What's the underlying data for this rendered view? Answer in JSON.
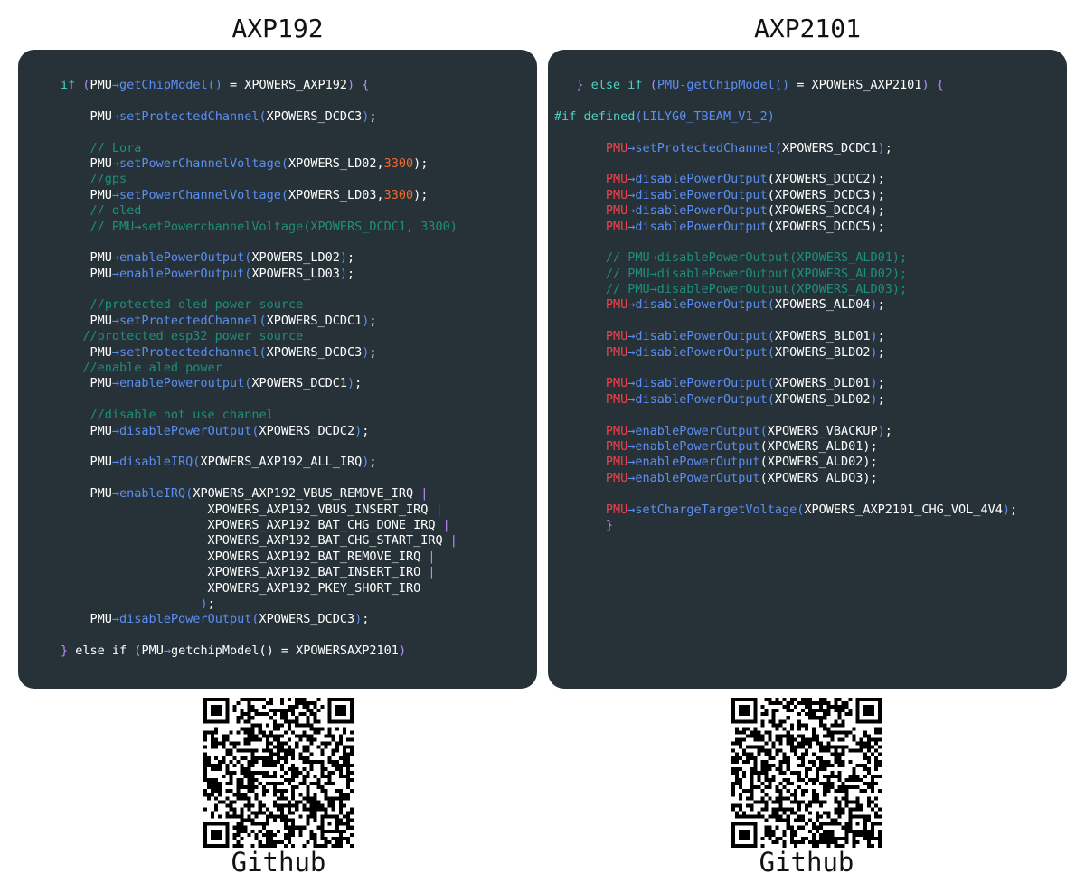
{
  "left": {
    "title": "AXP192",
    "qr_caption": "Github",
    "code": [
      {
        "indent": 0,
        "t": [
          [
            "k",
            "if "
          ],
          [
            "p",
            "("
          ],
          [
            "w",
            "PMU"
          ],
          [
            "f",
            "→getChipModel()"
          ],
          [
            "w",
            " = XPOWERS_AXP192"
          ],
          [
            "p",
            ")"
          ],
          [
            "w",
            " "
          ],
          [
            "p",
            "{"
          ]
        ]
      },
      {
        "indent": 0,
        "t": []
      },
      {
        "indent": 0,
        "t": [
          [
            "w",
            "    PMU"
          ],
          [
            "f",
            "→setProtectedChannel("
          ],
          [
            "w",
            "XPOWERS_DCDC3"
          ],
          [
            "f",
            ")"
          ],
          [
            "w",
            ";"
          ]
        ]
      },
      {
        "indent": 0,
        "t": []
      },
      {
        "indent": 0,
        "t": [
          [
            "c",
            "    // Lora"
          ]
        ]
      },
      {
        "indent": 0,
        "t": [
          [
            "w",
            "    PMU"
          ],
          [
            "f",
            "→setPowerChannelVoltage("
          ],
          [
            "w",
            "XPOWERS_LD02,"
          ],
          [
            "n",
            "3300"
          ],
          [
            "w",
            ");"
          ]
        ]
      },
      {
        "indent": 0,
        "t": [
          [
            "c",
            "    //gps"
          ]
        ]
      },
      {
        "indent": 0,
        "t": [
          [
            "w",
            "    PMU"
          ],
          [
            "f",
            "→setPowerChannelVoltage("
          ],
          [
            "w",
            "XPOWERS_LD03,"
          ],
          [
            "n",
            "3300"
          ],
          [
            "w",
            ");"
          ]
        ]
      },
      {
        "indent": 0,
        "t": [
          [
            "c",
            "    // oled"
          ]
        ]
      },
      {
        "indent": 0,
        "t": [
          [
            "c",
            "    // PMU→setPowerchannelVoltage(XPOWERS_DCDC1, 3300)"
          ]
        ]
      },
      {
        "indent": 0,
        "t": []
      },
      {
        "indent": 0,
        "t": [
          [
            "w",
            "    PMU"
          ],
          [
            "f",
            "→enablePowerOutput("
          ],
          [
            "w",
            "XPOWERS_LD02"
          ],
          [
            "f",
            ")"
          ],
          [
            "w",
            ";"
          ]
        ]
      },
      {
        "indent": 0,
        "t": [
          [
            "w",
            "    PMU"
          ],
          [
            "f",
            "→enablePowerOutput("
          ],
          [
            "w",
            "XPOWERS_LD03"
          ],
          [
            "f",
            ")"
          ],
          [
            "w",
            ";"
          ]
        ]
      },
      {
        "indent": 0,
        "t": []
      },
      {
        "indent": 0,
        "t": [
          [
            "c",
            "    //protected oled power source"
          ]
        ]
      },
      {
        "indent": 0,
        "t": [
          [
            "w",
            "    PMU"
          ],
          [
            "f",
            "→setProtectedChannel("
          ],
          [
            "w",
            "XPOWERS_DCDC1"
          ],
          [
            "f",
            ")"
          ],
          [
            "w",
            ";"
          ]
        ]
      },
      {
        "indent": 0,
        "t": [
          [
            "c",
            "   //protected esp32 power source"
          ]
        ]
      },
      {
        "indent": 0,
        "t": [
          [
            "w",
            "    PMU"
          ],
          [
            "f",
            "→setProtectedchannel("
          ],
          [
            "w",
            "XPOWERS_DCDC3"
          ],
          [
            "f",
            ")"
          ],
          [
            "w",
            ";"
          ]
        ]
      },
      {
        "indent": 0,
        "t": [
          [
            "c",
            "   //enable aled power"
          ]
        ]
      },
      {
        "indent": 0,
        "t": [
          [
            "w",
            "    PMU"
          ],
          [
            "f",
            "→enablePoweroutput("
          ],
          [
            "w",
            "XPOWERS_DCDC1"
          ],
          [
            "f",
            ")"
          ],
          [
            "w",
            ";"
          ]
        ]
      },
      {
        "indent": 0,
        "t": []
      },
      {
        "indent": 0,
        "t": [
          [
            "c",
            "    //disable not use channel"
          ]
        ]
      },
      {
        "indent": 0,
        "t": [
          [
            "w",
            "    PMU"
          ],
          [
            "f",
            "→disablePowerOutput("
          ],
          [
            "w",
            "XPOWERS_DCDC2"
          ],
          [
            "f",
            ")"
          ],
          [
            "w",
            ";"
          ]
        ]
      },
      {
        "indent": 0,
        "t": []
      },
      {
        "indent": 0,
        "t": [
          [
            "w",
            "    PMU"
          ],
          [
            "f",
            "→disableIRQ("
          ],
          [
            "w",
            "XPOWERS_AXP192_ALL_IRQ"
          ],
          [
            "f",
            ")"
          ],
          [
            "w",
            ";"
          ]
        ]
      },
      {
        "indent": 0,
        "t": []
      },
      {
        "indent": 0,
        "t": [
          [
            "w",
            "    PMU"
          ],
          [
            "f",
            "→enableIRQ("
          ],
          [
            "w",
            "XPOWERS_AXP192_VBUS_REMOVE_IRQ "
          ],
          [
            "p",
            "|"
          ]
        ]
      },
      {
        "indent": 0,
        "t": [
          [
            "w",
            "                    XPOWERS_AXP192_VBUS_INSERT_IRQ "
          ],
          [
            "p",
            "|"
          ]
        ]
      },
      {
        "indent": 0,
        "t": [
          [
            "w",
            "                    XPOWERS_AXP192 BAT_CHG_DONE_IRQ "
          ],
          [
            "p",
            "|"
          ]
        ]
      },
      {
        "indent": 0,
        "t": [
          [
            "w",
            "                    XPOWERS_AXP192_BAT_CHG_START_IRQ "
          ],
          [
            "p",
            "|"
          ]
        ]
      },
      {
        "indent": 0,
        "t": [
          [
            "w",
            "                    XPOWERS_AXP192_BAT_REMOVE_IRQ "
          ],
          [
            "p",
            "|"
          ]
        ]
      },
      {
        "indent": 0,
        "t": [
          [
            "w",
            "                    XPOWERS_AXP192_BAT_INSERT_IRO "
          ],
          [
            "p",
            "|"
          ]
        ]
      },
      {
        "indent": 0,
        "t": [
          [
            "w",
            "                    XPOWERS_AXP192_PKEY_SHORT_IRO"
          ]
        ]
      },
      {
        "indent": 0,
        "t": [
          [
            "w",
            "                   "
          ],
          [
            "f",
            ")"
          ],
          [
            "w",
            ";"
          ]
        ]
      },
      {
        "indent": 0,
        "t": [
          [
            "w",
            "    PMU"
          ],
          [
            "f",
            "→disablePowerOutput("
          ],
          [
            "w",
            "XPOWERS_DCDC3"
          ],
          [
            "f",
            ")"
          ],
          [
            "w",
            ";"
          ]
        ]
      },
      {
        "indent": 0,
        "t": []
      },
      {
        "indent": 0,
        "t": [
          [
            "p",
            "}"
          ],
          [
            "w",
            " else if "
          ],
          [
            "p",
            "("
          ],
          [
            "w",
            "PMU"
          ],
          [
            "f",
            "→"
          ],
          [
            "w",
            "getchipModel() = XPOWERSAXP2101"
          ],
          [
            "p",
            ")"
          ]
        ]
      }
    ]
  },
  "right": {
    "title": "AXP2101",
    "qr_caption": "Github",
    "code": [
      {
        "indent": 0,
        "t": [
          [
            "w",
            "   "
          ],
          [
            "p",
            "}"
          ],
          [
            "k",
            " else if "
          ],
          [
            "p",
            "("
          ],
          [
            "f",
            "PMU-getChipModel()"
          ],
          [
            "w",
            " = XPOWERS_AXP2101"
          ],
          [
            "p",
            ")"
          ],
          [
            "w",
            " "
          ],
          [
            "p",
            "{"
          ]
        ]
      },
      {
        "indent": 0,
        "t": []
      },
      {
        "indent": 0,
        "t": [
          [
            "k",
            "#if defined"
          ],
          [
            "f",
            "(LILYG0_TBEAM_V1_2)"
          ]
        ]
      },
      {
        "indent": 0,
        "t": []
      },
      {
        "indent": 0,
        "t": [
          [
            "w",
            "       "
          ],
          [
            "r",
            "PMU"
          ],
          [
            "f",
            "→setProtectedChannel("
          ],
          [
            "w",
            "XPOWERS_DCDC1"
          ],
          [
            "f",
            ")"
          ],
          [
            "w",
            ";"
          ]
        ]
      },
      {
        "indent": 0,
        "t": []
      },
      {
        "indent": 0,
        "t": [
          [
            "w",
            "       "
          ],
          [
            "r",
            "PMU"
          ],
          [
            "f",
            "→disablePowerOutput"
          ],
          [
            "w",
            "(XPOWERS_DCDC2);"
          ]
        ]
      },
      {
        "indent": 0,
        "t": [
          [
            "w",
            "       "
          ],
          [
            "r",
            "PMU"
          ],
          [
            "f",
            "→disablePowerOutput"
          ],
          [
            "w",
            "(XPOWERS_DCDC3);"
          ]
        ]
      },
      {
        "indent": 0,
        "t": [
          [
            "w",
            "       "
          ],
          [
            "r",
            "PMU"
          ],
          [
            "f",
            "→disablePowerOutput"
          ],
          [
            "w",
            "(XPOWERS_DCDC4);"
          ]
        ]
      },
      {
        "indent": 0,
        "t": [
          [
            "w",
            "       "
          ],
          [
            "r",
            "PMU"
          ],
          [
            "f",
            "→disablePowerOutput"
          ],
          [
            "w",
            "(XPOWERS_DCDC5);"
          ]
        ]
      },
      {
        "indent": 0,
        "t": []
      },
      {
        "indent": 0,
        "t": [
          [
            "c",
            "       // PMU→disablePowerOutput(XPOWERS_ALD01);"
          ]
        ]
      },
      {
        "indent": 0,
        "t": [
          [
            "c",
            "       // PMU→disablePowerOutput(XPOWERS_ALD02);"
          ]
        ]
      },
      {
        "indent": 0,
        "t": [
          [
            "c",
            "       // PMU→disablePowerOutput(XPOWERS_ALD03);"
          ]
        ]
      },
      {
        "indent": 0,
        "t": [
          [
            "w",
            "       "
          ],
          [
            "r",
            "PMU"
          ],
          [
            "f",
            "→disablePowerOutput("
          ],
          [
            "w",
            "XPOWERS_ALD04"
          ],
          [
            "f",
            ")"
          ],
          [
            "w",
            ";"
          ]
        ]
      },
      {
        "indent": 0,
        "t": []
      },
      {
        "indent": 0,
        "t": [
          [
            "w",
            "       "
          ],
          [
            "r",
            "PMU"
          ],
          [
            "f",
            "→disablePowerOutput("
          ],
          [
            "w",
            "XPOWERS_BLD01"
          ],
          [
            "f",
            ")"
          ],
          [
            "w",
            ";"
          ]
        ]
      },
      {
        "indent": 0,
        "t": [
          [
            "w",
            "       "
          ],
          [
            "r",
            "PMU"
          ],
          [
            "f",
            "→disablePowerOutput("
          ],
          [
            "w",
            "XPOWERS_BLDO2"
          ],
          [
            "f",
            ")"
          ],
          [
            "w",
            ";"
          ]
        ]
      },
      {
        "indent": 0,
        "t": []
      },
      {
        "indent": 0,
        "t": [
          [
            "w",
            "       "
          ],
          [
            "r",
            "PMU"
          ],
          [
            "f",
            "→disablePowerOutput("
          ],
          [
            "w",
            "XPOWERS_DLD01"
          ],
          [
            "f",
            ")"
          ],
          [
            "w",
            ";"
          ]
        ]
      },
      {
        "indent": 0,
        "t": [
          [
            "w",
            "       "
          ],
          [
            "r",
            "PMU"
          ],
          [
            "f",
            "→disablePowerOutput("
          ],
          [
            "w",
            "XPOWERS_DLD02"
          ],
          [
            "f",
            ")"
          ],
          [
            "w",
            ";"
          ]
        ]
      },
      {
        "indent": 0,
        "t": []
      },
      {
        "indent": 0,
        "t": [
          [
            "w",
            "       "
          ],
          [
            "r",
            "PMU"
          ],
          [
            "f",
            "→enablePowerOutput("
          ],
          [
            "w",
            "XPOWERS_VBACKUP"
          ],
          [
            "f",
            ")"
          ],
          [
            "w",
            ";"
          ]
        ]
      },
      {
        "indent": 0,
        "t": [
          [
            "w",
            "       "
          ],
          [
            "r",
            "PMU"
          ],
          [
            "f",
            "→enablePowerOutput"
          ],
          [
            "w",
            "(XPOWERS_ALD01);"
          ]
        ]
      },
      {
        "indent": 0,
        "t": [
          [
            "w",
            "       "
          ],
          [
            "r",
            "PMU"
          ],
          [
            "f",
            "→enablePowerOutput"
          ],
          [
            "w",
            "(XPOWERS_ALD02);"
          ]
        ]
      },
      {
        "indent": 0,
        "t": [
          [
            "w",
            "       "
          ],
          [
            "r",
            "PMU"
          ],
          [
            "f",
            "→enablePowerOutput"
          ],
          [
            "w",
            "(XPOWERS ALDO3);"
          ]
        ]
      },
      {
        "indent": 0,
        "t": []
      },
      {
        "indent": 0,
        "t": [
          [
            "w",
            "       "
          ],
          [
            "r",
            "PMU"
          ],
          [
            "f",
            "→setChargeTargetVoltage("
          ],
          [
            "w",
            "XPOWERS_AXP2101_CHG_VOL_4V4"
          ],
          [
            "f",
            ")"
          ],
          [
            "w",
            ";"
          ]
        ]
      },
      {
        "indent": 0,
        "t": [
          [
            "w",
            "       "
          ],
          [
            "p",
            "}"
          ]
        ]
      }
    ]
  },
  "colors": {
    "panel_bg": "#263238",
    "function": "#5c8ef2",
    "keyword": "#4fd1c5",
    "paren": "#b58cff",
    "comment": "#1e8f7a",
    "number": "#f0682e",
    "pmu_red": "#f0414b"
  }
}
